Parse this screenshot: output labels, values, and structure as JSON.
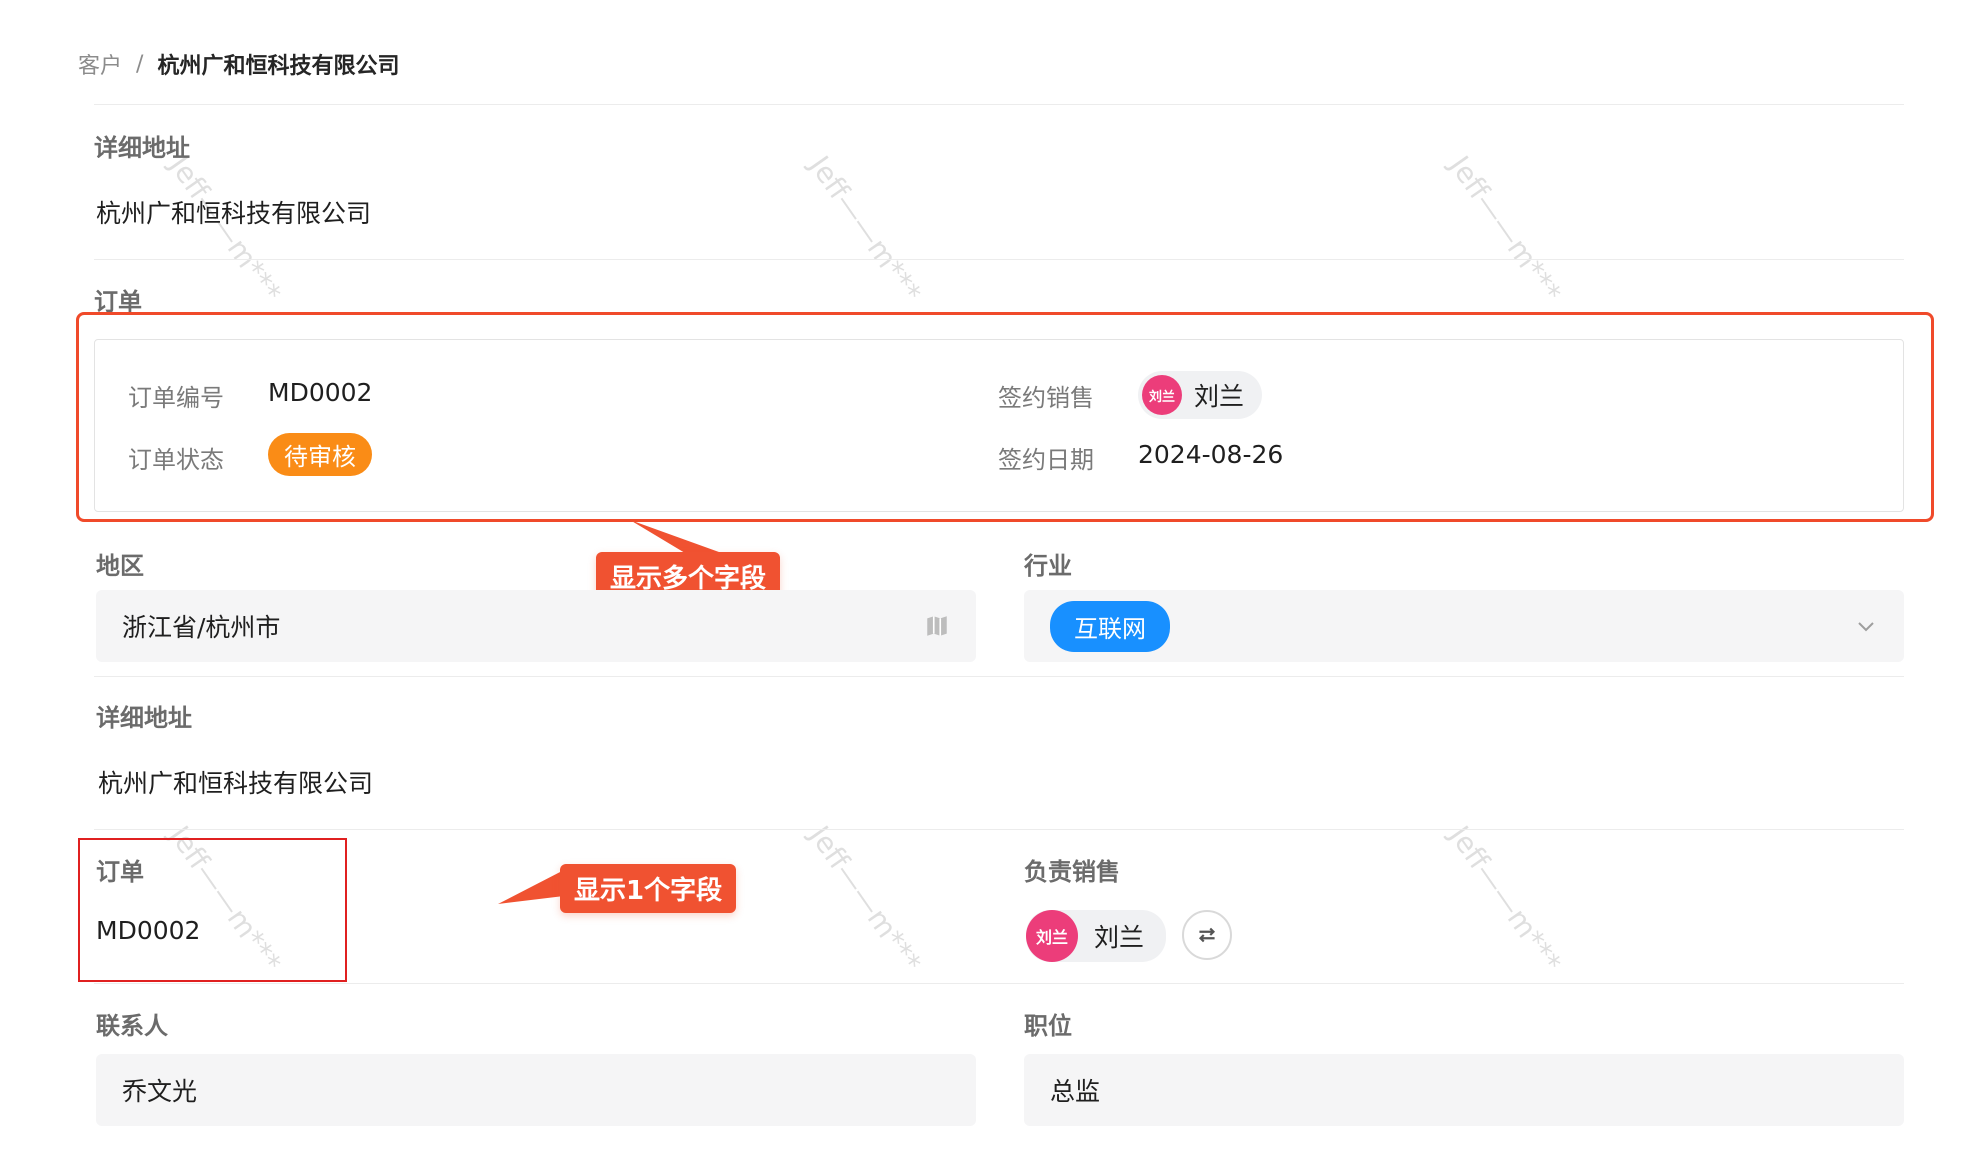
{
  "breadcrumb": {
    "parent": "客户",
    "separator": "/",
    "current": "杭州广和恒科技有限公司"
  },
  "section1": {
    "label": "详细地址",
    "value": "杭州广和恒科技有限公司"
  },
  "order_section": {
    "label": "订单",
    "fields": {
      "order_no_label": "订单编号",
      "order_no": "MD0002",
      "status_label": "订单状态",
      "status": "待审核",
      "sales_label": "签约销售",
      "sales_avatar": "刘兰",
      "sales_name": "刘兰",
      "date_label": "签约日期",
      "date": "2024-08-26"
    }
  },
  "region": {
    "label": "地区",
    "value": "浙江省/杭州市"
  },
  "industry": {
    "label": "行业",
    "value": "互联网"
  },
  "section2": {
    "label": "详细地址",
    "value": "杭州广和恒科技有限公司"
  },
  "order_single": {
    "label": "订单",
    "value": "MD0002"
  },
  "owner": {
    "label": "负责销售",
    "avatar": "刘兰",
    "name": "刘兰"
  },
  "contact": {
    "label": "联系人",
    "value": "乔文光"
  },
  "position": {
    "label": "职位",
    "value": "总监"
  },
  "callouts": {
    "multi": "显示多个字段",
    "single": "显示1个字段"
  },
  "watermark": "Jeff——m***",
  "colors": {
    "status_tag": "#fa8c16",
    "industry_tag": "#1890ff",
    "avatar": "#ec3d7a",
    "callout": "#f05231",
    "highlight": "#e02020"
  }
}
